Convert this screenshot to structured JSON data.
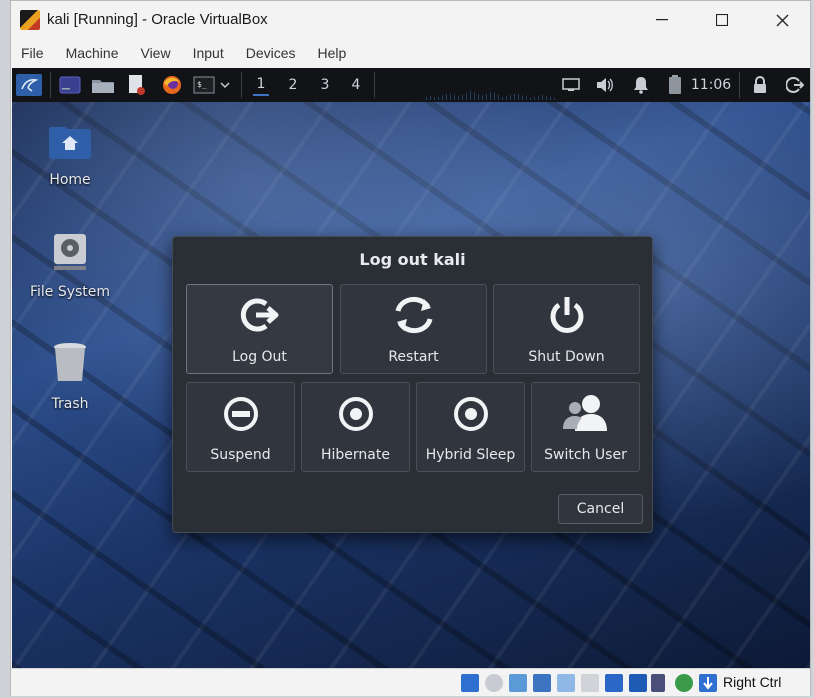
{
  "window": {
    "title": "kali [Running] - Oracle VirtualBox",
    "minimize": "—",
    "maximize": "☐",
    "close": "✕"
  },
  "menu": [
    "File",
    "Machine",
    "View",
    "Input",
    "Devices",
    "Help"
  ],
  "panel": {
    "workspaces": [
      "1",
      "2",
      "3",
      "4"
    ],
    "active_workspace": "1",
    "clock": "11:06",
    "icons": [
      "kali-menu-icon",
      "terminal-icon",
      "files-icon",
      "text-editor-icon",
      "firefox-icon",
      "terminal-emulator-icon",
      "chevron-down-icon",
      "display-icon",
      "volume-icon",
      "notifications-icon",
      "battery-icon",
      "lock-icon",
      "logout-icon"
    ]
  },
  "desktop": {
    "icons": [
      {
        "label": "Home"
      },
      {
        "label": "File System"
      },
      {
        "label": "Trash"
      }
    ]
  },
  "dialog": {
    "title": "Log out kali",
    "buttons": [
      "Log Out",
      "Restart",
      "Shut Down",
      "Suspend",
      "Hibernate",
      "Hybrid Sleep",
      "Switch User"
    ],
    "cancel": "Cancel"
  },
  "statusbar": {
    "host_key": "Right Ctrl"
  },
  "colors": {
    "accent": "#3e73c4",
    "dialog_bg": "#2a2e35",
    "panel_bg": "#111317"
  }
}
